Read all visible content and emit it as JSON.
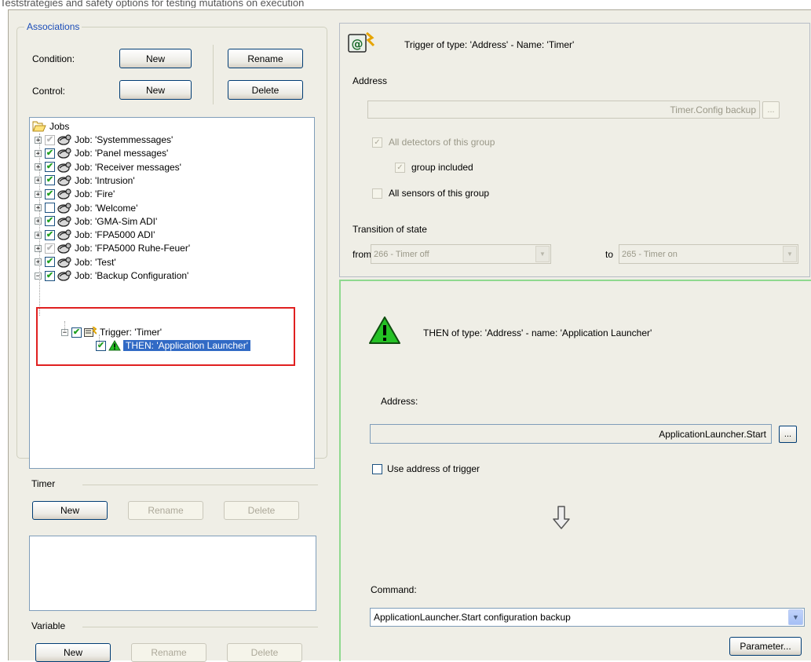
{
  "top_caption": "Teststrategies and safety options for testing mutations on execution",
  "associations": {
    "legend": "Associations",
    "condition_label": "Condition:",
    "control_label": "Control:",
    "new_label": "New",
    "rename_label": "Rename",
    "delete_label": "Delete"
  },
  "tree": {
    "root": "Jobs",
    "jobs": [
      {
        "label": "Job: 'Systemmessages'",
        "check": "grey"
      },
      {
        "label": "Job: 'Panel messages'",
        "check": "on"
      },
      {
        "label": "Job: 'Receiver messages'",
        "check": "on"
      },
      {
        "label": "Job: 'Intrusion'",
        "check": "on"
      },
      {
        "label": "Job: 'Fire'",
        "check": "on"
      },
      {
        "label": "Job: 'Welcome'",
        "check": "off"
      },
      {
        "label": "Job: 'GMA-Sim ADI'",
        "check": "on"
      },
      {
        "label": "Job: 'FPA5000 ADI'",
        "check": "on"
      },
      {
        "label": "Job: 'FPA5000 Ruhe-Feuer'",
        "check": "grey"
      },
      {
        "label": "Job: 'Test'",
        "check": "on"
      },
      {
        "label": "Job: 'Backup Configuration'",
        "check": "on"
      }
    ],
    "trigger": "Trigger: 'Timer'",
    "then": "THEN: 'Application Launcher'"
  },
  "timer": {
    "legend": "Timer",
    "new_label": "New",
    "rename_label": "Rename",
    "delete_label": "Delete"
  },
  "variable": {
    "legend": "Variable",
    "new_label": "New",
    "rename_label": "Rename",
    "delete_label": "Delete"
  },
  "trigger_panel": {
    "title": "Trigger of type: 'Address'  -  Name: 'Timer'",
    "address_label": "Address",
    "address_value": "Timer.Config backup",
    "browse_label": "...",
    "all_detectors_label": "All detectors of this group",
    "group_included_label": "group included",
    "all_sensors_label": "All sensors of this group",
    "transition_label": "Transition of state",
    "from_label": "from",
    "from_value": "266 - Timer off",
    "to_label": "to",
    "to_value": "265 - Timer on"
  },
  "then_panel": {
    "title": "THEN of type: 'Address'  -  name: 'Application Launcher'",
    "address_label": "Address:",
    "address_value": "ApplicationLauncher.Start",
    "browse_label": "...",
    "use_address_label": "Use address of trigger",
    "command_label": "Command:",
    "command_value": "ApplicationLauncher.Start configuration backup",
    "parameter_label": "Parameter..."
  },
  "colors": {
    "highlight_box": "#e02020",
    "selection": "#316ac5",
    "green_border": "#8fd98f",
    "warning_fill": "#25c125"
  }
}
